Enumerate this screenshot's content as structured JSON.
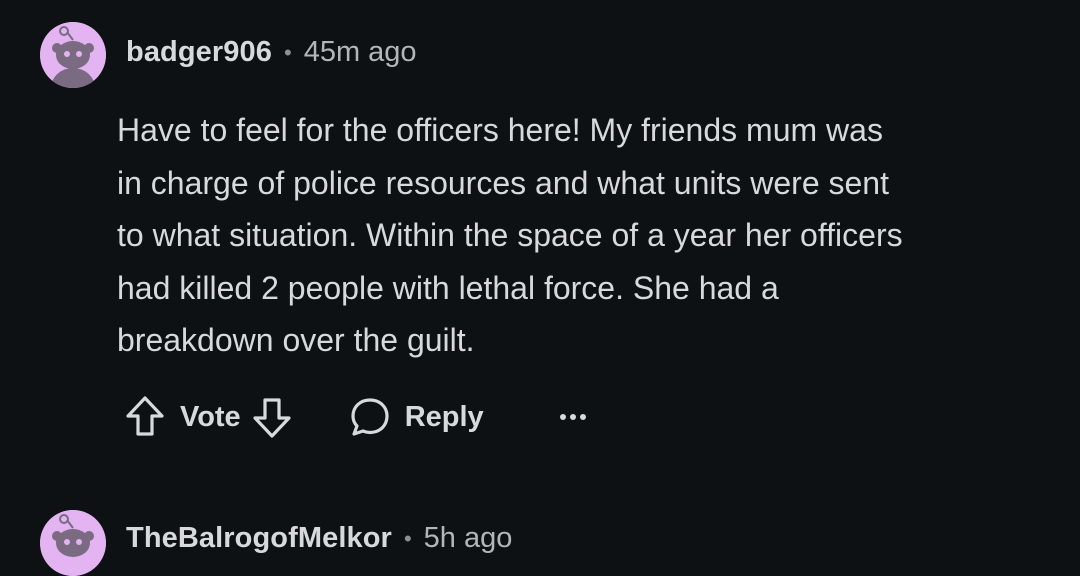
{
  "comments": [
    {
      "username": "badger906",
      "separator": "•",
      "time": "45m ago",
      "avatar_color": "#e3b3f2",
      "body_lines": [
        "Have to feel for the officers here! My friends mum was",
        "in charge of police resources and what units were sent",
        "to what situation. Within the space of a year her officers",
        "had killed 2 people with lethal force. She had a",
        "breakdown over the guilt."
      ],
      "actions": {
        "vote_label": "Vote",
        "reply_label": "Reply",
        "upvote_icon": "arrow-up-icon",
        "downvote_icon": "arrow-down-icon",
        "reply_icon": "speech-bubble-icon",
        "more_icon": "more-dots-icon"
      }
    },
    {
      "username": "TheBalrogofMelkor",
      "separator": "•",
      "time": "5h ago",
      "avatar_color": "#e3b3f2"
    }
  ],
  "colors": {
    "background": "#0e1113",
    "text": "#d7dadc",
    "muted": "#b0b6ba"
  }
}
